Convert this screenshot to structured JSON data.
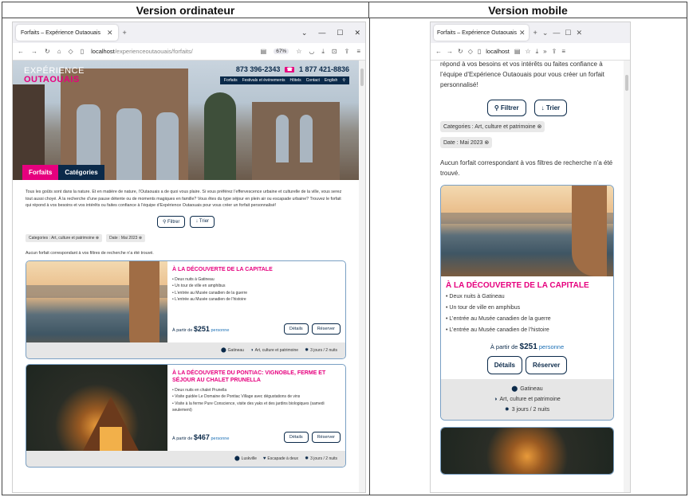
{
  "headers": {
    "desktop": "Version ordinateur",
    "mobile": "Version mobile"
  },
  "browser": {
    "tab_title": "Forfaits – Expérience Outaouais",
    "tab_title_mobile": "Forfaits – Expérience Outaouais",
    "url_host": "localhost",
    "url_path": "/experienceoutaouais/forfaits/",
    "url_mobile": "localhost",
    "zoom": "67%"
  },
  "site": {
    "logo_line1": "EXPÉRIENCE",
    "logo_line2": "OUTAOUAIS",
    "phone1": "873 396-2343",
    "phone2": "1 877 421-8836",
    "nav": [
      "Forfaits",
      "Festivals et événements",
      "Hôtels",
      "Contact",
      "English"
    ],
    "hero_tabs": [
      "Forfaits",
      "Catégories"
    ],
    "intro": "Tous les goûts sont dans la nature. Et en matière de nature, l’Outaouais a de quoi vous plaire. Si vous préférez l’effervescence urbaine et culturelle de la ville, vous serez tout aussi choyé. À la recherche d’une pause détente ou de moments magiques en famille? Vous êtes du type séjour en plein air ou escapade urbaine? Trouvez le forfait qui répond à vos besoins et vos intérêts ou faites confiance à l’équipe d’Expérience Outaouais pour vous créer un forfait personnalisé!",
    "filter": "Filtrer",
    "sort": "Trier",
    "chip_cat": "Categories : Art, culture et patrimoine",
    "chip_date": "Date : Mai 2023",
    "no_result": "Aucun forfait correspondant à vos filtres de recherche n’a été trouvé.",
    "mobile_intro": "répond à vos besoins et vos intérêts ou faites confiance à l’équipe d’Expérience Outaouais pour vous créer un forfait personnalisé!",
    "price_prefix": "À partir de",
    "price_suffix": "personne",
    "details": "Détails",
    "book": "Réserver"
  },
  "cards": [
    {
      "title": "À LA DÉCOUVERTE DE LA CAPITALE",
      "items": [
        "Deux nuits à Gatineau",
        "Un tour de ville en amphibus",
        "L’entrée au Musée canadien de la guerre",
        "L’entrée au Musée canadien de l’histoire"
      ],
      "price": "$251",
      "place": "Gatineau",
      "category": "Art, culture et patrimoine",
      "duration": "3 jours / 2 nuits"
    },
    {
      "title": "À LA DÉCOUVERTE DU PONTIAC: VIGNOBLE, FERME ET SÉJOUR AU CHALET PRUNELLA",
      "items": [
        "Deux nuits en chalet Prunella",
        "Visite guidée Le Domaine de Pontiac Village avec dégustations de vins",
        "Visite à la ferme Pure Conscience, visite des yaks et des jardins biologiques (samedi seulement)"
      ],
      "price": "$467",
      "place": "Luskville",
      "category": "Escapade à deux",
      "duration": "3 jours / 2 nuits"
    }
  ],
  "colors": {
    "brand_pink": "#e6007e",
    "brand_navy": "#0b2a4a"
  }
}
